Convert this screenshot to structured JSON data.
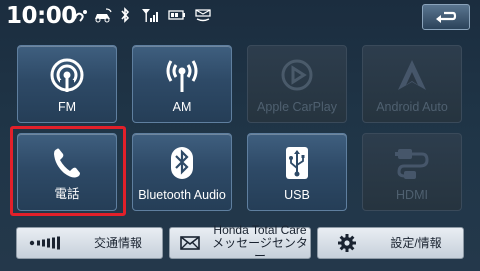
{
  "status": {
    "time": "10:00",
    "icons": [
      "voice-recognition-icon",
      "car-connect-icon",
      "bluetooth-icon",
      "signal-strength-icon",
      "battery-icon",
      "message-icon"
    ]
  },
  "header": {
    "back_icon": "return-arrow-icon"
  },
  "sources": [
    {
      "label": "FM",
      "icon": "radio-broadcast-icon",
      "enabled": true
    },
    {
      "label": "AM",
      "icon": "radio-waves-icon",
      "enabled": true
    },
    {
      "label": "Apple CarPlay",
      "icon": "carplay-icon",
      "enabled": false
    },
    {
      "label": "Android Auto",
      "icon": "android-auto-icon",
      "enabled": false
    },
    {
      "label": "電話",
      "icon": "phone-icon",
      "enabled": true,
      "selected": true
    },
    {
      "label": "Bluetooth Audio",
      "icon": "bluetooth-icon",
      "enabled": true
    },
    {
      "label": "USB",
      "icon": "usb-icon",
      "enabled": true
    },
    {
      "label": "HDMI",
      "icon": "hdmi-icon",
      "enabled": false
    }
  ],
  "bottom_bar": [
    {
      "label": "交通情報",
      "icon": "traffic-info-icon"
    },
    {
      "label_line1": "Honda Total Care",
      "label_line2": "メッセージセンター",
      "icon": "envelope-icon"
    },
    {
      "label": "設定/情報",
      "icon": "gear-icon"
    }
  ],
  "colors": {
    "selection": "#e2202a",
    "tile_top": "#3f5f7f",
    "background": "#1b2d3f"
  }
}
